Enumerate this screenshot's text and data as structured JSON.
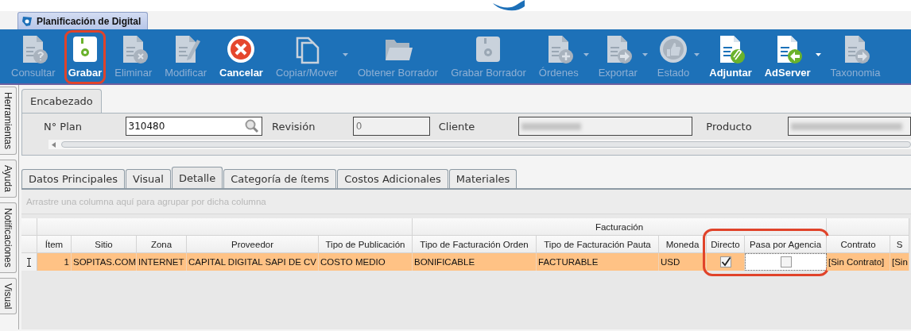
{
  "window": {
    "tab": "Planificación de Digital"
  },
  "toolbar": [
    {
      "label": "Consultar",
      "disabled": true,
      "dropdown": false,
      "highlighted": false
    },
    {
      "label": "Grabar",
      "disabled": false,
      "dropdown": false,
      "highlighted": true
    },
    {
      "label": "Eliminar",
      "disabled": true,
      "dropdown": false,
      "highlighted": false
    },
    {
      "label": "Modificar",
      "disabled": true,
      "dropdown": false,
      "highlighted": false
    },
    {
      "label": "Cancelar",
      "disabled": false,
      "dropdown": false,
      "highlighted": false
    },
    {
      "label": "Copiar/Mover",
      "disabled": true,
      "dropdown": true,
      "highlighted": false
    },
    {
      "label": "Obtener Borrador",
      "disabled": true,
      "dropdown": false,
      "highlighted": false
    },
    {
      "label": "Grabar Borrador",
      "disabled": true,
      "dropdown": false,
      "highlighted": false
    },
    {
      "label": "Órdenes",
      "disabled": true,
      "dropdown": true,
      "highlighted": false
    },
    {
      "label": "Exportar",
      "disabled": true,
      "dropdown": true,
      "highlighted": false
    },
    {
      "label": "Estado",
      "disabled": true,
      "dropdown": true,
      "highlighted": false
    },
    {
      "label": "Adjuntar",
      "disabled": false,
      "dropdown": false,
      "highlighted": false
    },
    {
      "label": "AdServer",
      "disabled": false,
      "dropdown": true,
      "highlighted": false
    },
    {
      "label": "Taxonomia",
      "disabled": true,
      "dropdown": false,
      "highlighted": false
    }
  ],
  "side_tabs": [
    {
      "label": "Herramientas"
    },
    {
      "label": "Ayuda"
    },
    {
      "label": "Notificaciones"
    },
    {
      "label": "Visual"
    }
  ],
  "header": {
    "tab": "Encabezado",
    "fields": [
      {
        "label": "N° Plan",
        "value": "310480",
        "search": true,
        "readonly": false
      },
      {
        "label": "Revisión",
        "value": "0",
        "search": false,
        "readonly": true
      },
      {
        "label": "Cliente",
        "search": false,
        "readonly": true
      },
      {
        "label": "Producto",
        "search": false,
        "readonly": true
      }
    ]
  },
  "detail_tabs": [
    {
      "label": "Datos Principales",
      "selected": false
    },
    {
      "label": "Visual",
      "selected": false
    },
    {
      "label": "Detalle",
      "selected": true
    },
    {
      "label": "Categoría de ítems",
      "selected": false
    },
    {
      "label": "Costos Adicionales",
      "selected": false
    },
    {
      "label": "Materiales",
      "selected": false
    }
  ],
  "grid": {
    "group_panel": "Arrastre una columna aquí para agrupar por dicha columna",
    "column_groups": [
      {
        "subgroups": [
          {
            "highlighted": false,
            "columns": [
              {
                "label": "Ítem",
                "kind": "number"
              },
              {
                "label": "Sitio",
                "kind": "text"
              },
              {
                "label": "Zona",
                "kind": "text"
              },
              {
                "label": "Proveedor",
                "kind": "text"
              },
              {
                "label": "Tipo de Publicación",
                "kind": "text"
              }
            ]
          }
        ]
      },
      {
        "band": "Facturación",
        "subgroups": [
          {
            "highlighted": false,
            "columns": [
              {
                "label": "Tipo de Facturación Orden",
                "kind": "text"
              },
              {
                "label": "Tipo de Facturación Pauta",
                "kind": "text"
              },
              {
                "label": "Moneda",
                "kind": "text"
              }
            ]
          },
          {
            "highlighted": true,
            "columns": [
              {
                "label": "Directo",
                "kind": "check"
              },
              {
                "label": "Pasa por Agencia",
                "kind": "check"
              }
            ]
          }
        ]
      },
      {
        "subgroups": [
          {
            "highlighted": false,
            "columns": [
              {
                "label": "Contrato",
                "kind": "text"
              },
              {
                "label": "S",
                "kind": "text"
              }
            ]
          }
        ]
      }
    ],
    "rows": [
      {
        "selected": true,
        "cells": [
          {
            "text": "1"
          },
          {
            "text": "SOPITAS.COM"
          },
          {
            "text": "INTERNET"
          },
          {
            "text": "CAPITAL DIGITAL SAPI DE CV"
          },
          {
            "text": "COSTO MEDIO"
          },
          {
            "text": "BONIFICABLE"
          },
          {
            "text": "FACTURABLE"
          },
          {
            "text": "USD"
          },
          {
            "checked": true,
            "focused": false
          },
          {
            "checked": false,
            "focused": true
          },
          {
            "text": "[Sin Contrato]"
          },
          {
            "text": "[Sin"
          }
        ]
      }
    ]
  }
}
